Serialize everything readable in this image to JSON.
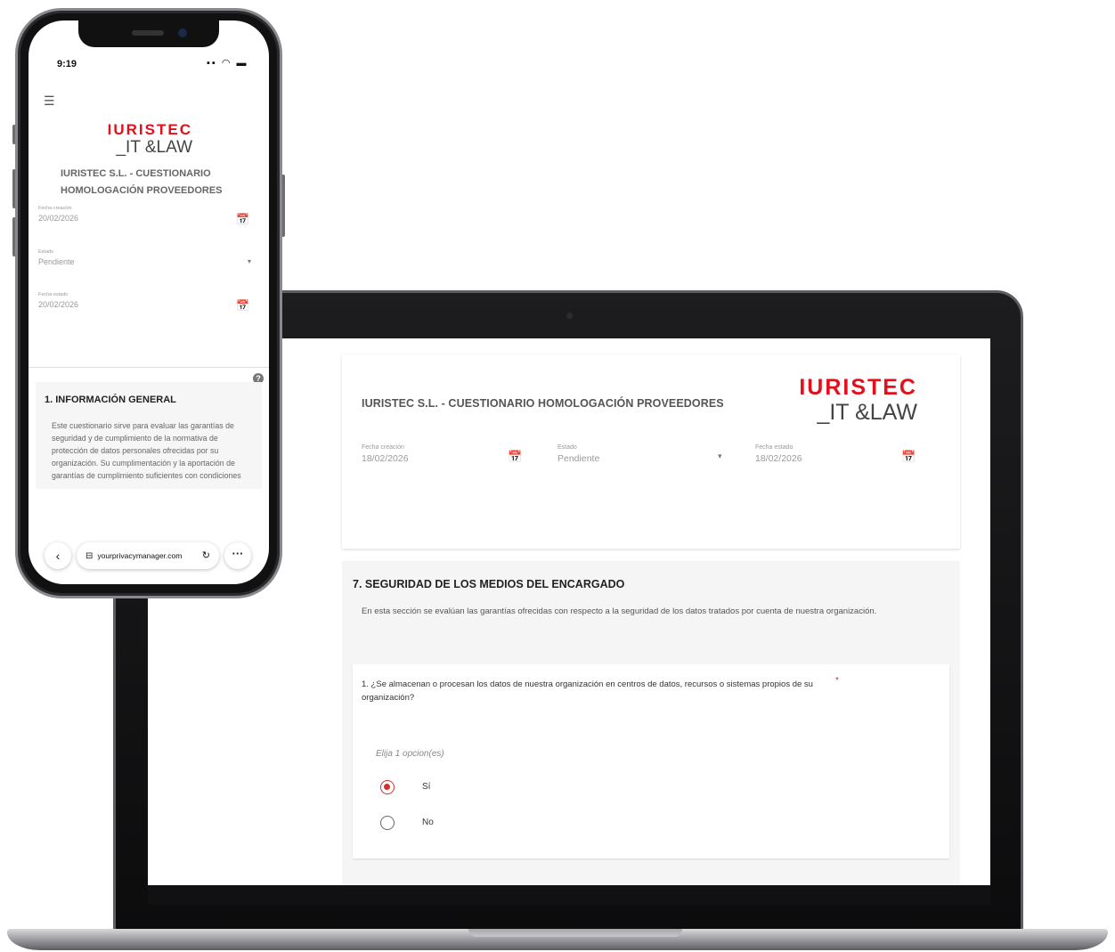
{
  "brand": {
    "logo_top": "IURISTEC",
    "logo_bottom": "_IT &LAW",
    "accent": "#e30f1b"
  },
  "desktop": {
    "title": "IURISTEC S.L. - CUESTIONARIO HOMOLOGACIÓN PROVEEDORES",
    "fields": {
      "creation": {
        "label": "Fecha creación",
        "value": "18/02/2026",
        "icon": "calendar-icon"
      },
      "status": {
        "label": "Estado",
        "value": "Pendiente",
        "icon": "dropdown-arrow-icon"
      },
      "status_date": {
        "label": "Fecha estado",
        "value": "18/02/2026",
        "icon": "calendar-icon"
      }
    },
    "section": {
      "title": "7. SEGURIDAD DE LOS MEDIOS DEL ENCARGADO",
      "description": "En esta sección se evalúan las garantías ofrecidas con respecto a la seguridad de los datos tratados por cuenta de nuestra organización."
    },
    "question": {
      "text": "1. ¿Se almacenan o procesan los datos de nuestra organización en centros de datos, recursos o sistemas propios de su organización?",
      "required_mark": "*",
      "hint": "Elija 1 opcion(es)",
      "options": [
        {
          "label": "Sí",
          "selected": true
        },
        {
          "label": "No",
          "selected": false
        }
      ]
    }
  },
  "mobile": {
    "status_time": "9:19",
    "status_icons": "▪▪ ◠ ▬",
    "menu_icon": "☰",
    "title": "IURISTEC S.L. - CUESTIONARIO HOMOLOGACIÓN PROVEEDORES",
    "fields": {
      "creation": {
        "label": "Fecha creación",
        "value": "20/02/2026"
      },
      "status": {
        "label": "Estado",
        "value": "Pendiente"
      },
      "status_date": {
        "label": "Fecha estado",
        "value": "20/02/2026"
      }
    },
    "help_icon": "?",
    "section": {
      "title": "1. INFORMACIÓN GENERAL",
      "description": "Este cuestionario sirve para evaluar las garantías de seguridad y de cumplimiento de la normativa de protección de datos personales ofrecidas por su organización. Su cumplimentación y la aportación de garantías de cumplimiento suficientes con condiciones"
    },
    "browser": {
      "back": "‹",
      "url": "yourprivacymanager.com",
      "reload": "↻",
      "more": "···"
    }
  }
}
